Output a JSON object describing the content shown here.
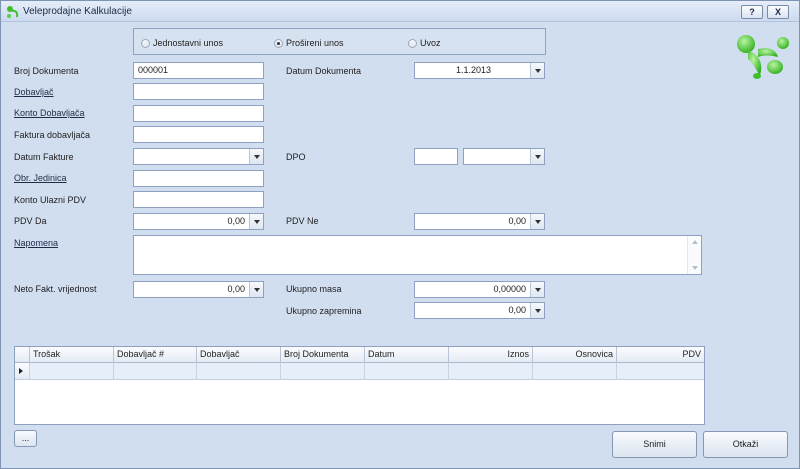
{
  "window": {
    "title": "Veleprodajne Kalkulacije",
    "help_label": "?",
    "close_label": "X"
  },
  "mode": {
    "options": [
      "Jednostavni unos",
      "Prošireni unos",
      "Uvoz"
    ],
    "selected": "Prošireni unos"
  },
  "form": {
    "broj_dokumenta": {
      "label": "Broj Dokumenta",
      "value": "000001"
    },
    "datum_dokumenta": {
      "label": "Datum Dokumenta",
      "value": "1.1.2013"
    },
    "dobavljac": {
      "label": "Dobavljač",
      "value": ""
    },
    "konto_dobavljaca": {
      "label": "Konto Dobavljača",
      "value": ""
    },
    "faktura_dobavljaca": {
      "label": "Faktura dobavljača",
      "value": ""
    },
    "datum_fakture": {
      "label": "Datum Fakture",
      "value": ""
    },
    "dpo": {
      "label": "DPO",
      "value": "",
      "select_value": ""
    },
    "obr_jedinica": {
      "label": "Obr. Jedinica",
      "value": ""
    },
    "konto_ulazni_pdv": {
      "label": "Konto Ulazni PDV",
      "value": ""
    },
    "pdv_da": {
      "label": "PDV Da",
      "value": "0,00"
    },
    "pdv_ne": {
      "label": "PDV Ne",
      "value": "0,00"
    },
    "napomena": {
      "label": "Napomena",
      "value": ""
    },
    "neto_fakt": {
      "label": "Neto Fakt. vrijednost",
      "value": "0,00"
    },
    "ukupno_masa": {
      "label": "Ukupno masa",
      "value": "0,00000"
    },
    "ukupno_zapremina": {
      "label": "Ukupno zapremina",
      "value": "0,00"
    }
  },
  "grid": {
    "columns": [
      "Trošak",
      "Dobavljač #",
      "Dobavljač",
      "Broj Dokumenta",
      "Datum",
      "Iznos",
      "Osnovica",
      "PDV"
    ]
  },
  "buttons": {
    "ellipsis": "...",
    "save": "Snimi",
    "cancel": "Otkaži"
  },
  "colors": {
    "background": "#d1def0",
    "logo_green": "#3fbf2a"
  },
  "icons": {
    "title": "app-leaf-icon",
    "logo": "green-swirl-logo-icon"
  }
}
